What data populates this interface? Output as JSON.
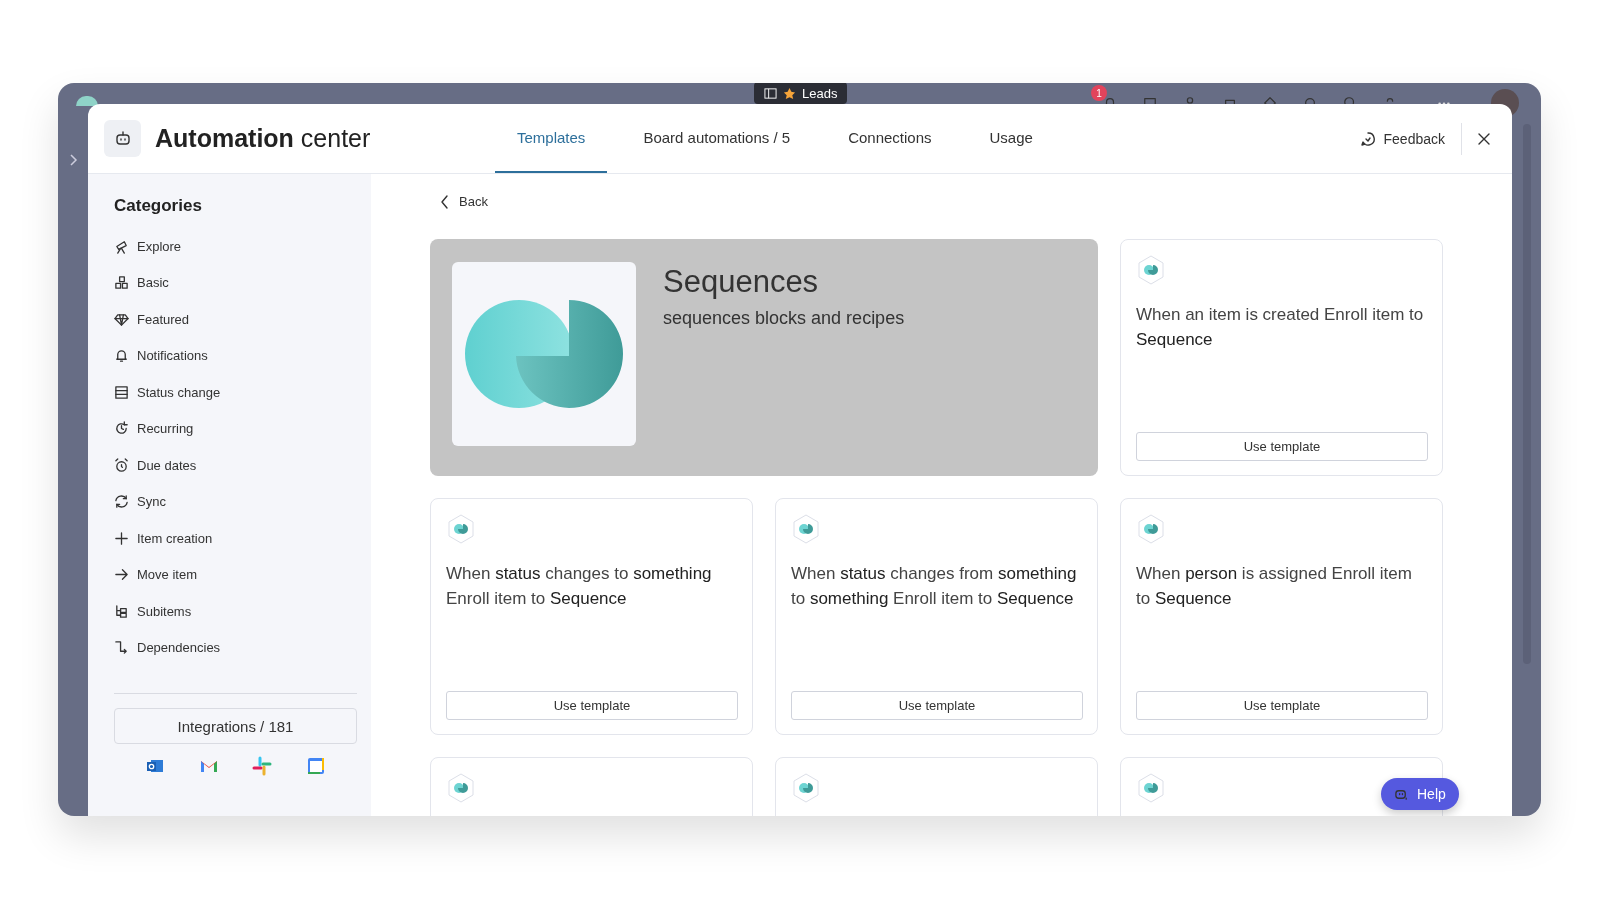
{
  "window": {
    "board_tab": "Leads",
    "notification_count": "1"
  },
  "header": {
    "title_bold": "Automation",
    "title_rest": "center",
    "feedback": "Feedback",
    "tabs": [
      {
        "label": "Templates",
        "selected": true
      },
      {
        "label": "Board automations / 5",
        "selected": false
      },
      {
        "label": "Connections",
        "selected": false
      },
      {
        "label": "Usage",
        "selected": false
      }
    ]
  },
  "sidebar": {
    "heading": "Categories",
    "items": [
      {
        "label": "Explore"
      },
      {
        "label": "Basic"
      },
      {
        "label": "Featured"
      },
      {
        "label": "Notifications"
      },
      {
        "label": "Status change"
      },
      {
        "label": "Recurring"
      },
      {
        "label": "Due dates"
      },
      {
        "label": "Sync"
      },
      {
        "label": "Item creation"
      },
      {
        "label": "Move item"
      },
      {
        "label": "Subitems"
      },
      {
        "label": "Dependencies"
      }
    ],
    "integrations_button": "Integrations / 181"
  },
  "back": "Back",
  "hero": {
    "title": "Sequences",
    "subtitle": "sequences blocks and recipes"
  },
  "templates": [
    {
      "kind": "full",
      "text": "When an item is created Enroll item to **Sequence**",
      "button": "Use template"
    },
    {
      "kind": "full",
      "text": "When **status** changes to **something** Enroll item to **Sequence**",
      "button": "Use template"
    },
    {
      "kind": "full",
      "text": "When **status** changes from **something** to **something** Enroll item to **Sequence**",
      "button": "Use template"
    },
    {
      "kind": "full",
      "text": "When **person** is assigned Enroll item to **Sequence**",
      "button": "Use template"
    },
    {
      "kind": "cut"
    },
    {
      "kind": "cut"
    },
    {
      "kind": "cut"
    }
  ],
  "help": "Help"
}
